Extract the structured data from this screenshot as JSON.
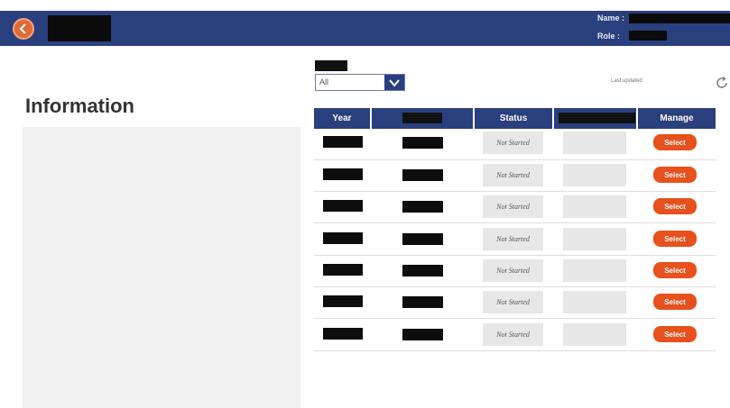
{
  "header": {
    "name_label": "Name :",
    "role_label": "Role :"
  },
  "filter": {
    "selected": "All"
  },
  "last_updated": "Last updated",
  "info": {
    "title": "Information"
  },
  "table": {
    "columns": [
      "Year",
      "",
      "Status",
      "",
      "Manage"
    ],
    "rows": [
      {
        "status": "Not Started",
        "action": "Select"
      },
      {
        "status": "Not Started",
        "action": "Select"
      },
      {
        "status": "Not Started",
        "action": "Select"
      },
      {
        "status": "Not Started",
        "action": "Select"
      },
      {
        "status": "Not Started",
        "action": "Select"
      },
      {
        "status": "Not Started",
        "action": "Select"
      },
      {
        "status": "Not Started",
        "action": "Select"
      }
    ]
  },
  "icons": {
    "back": "back-arrow-icon",
    "chevron": "chevron-down-icon",
    "refresh": "refresh-icon"
  },
  "colors": {
    "header_bg": "#2a3f7d",
    "select_btn": "#e8501c",
    "back_btn": "#e06a35"
  }
}
